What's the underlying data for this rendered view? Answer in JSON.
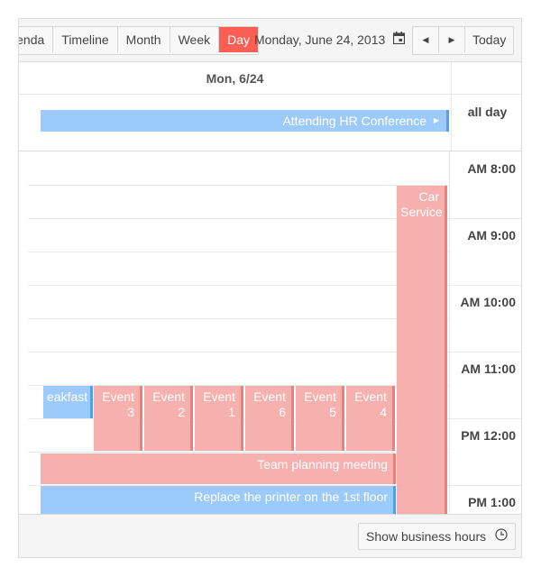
{
  "toolbar": {
    "views": [
      "Agenda",
      "Timeline",
      "Month",
      "Week",
      "Day"
    ],
    "active_view": "Day",
    "date": "Monday, June 24, 2013",
    "today": "Today",
    "accent": "#fd5e53"
  },
  "day_header": "Mon, 6/24",
  "all_day": {
    "label": "all day",
    "event": "Attending HR Conference"
  },
  "times": [
    "AM 8:00",
    "AM 9:00",
    "AM 10:00",
    "AM 11:00",
    "PM 12:00",
    "PM 1:00"
  ],
  "events": {
    "car_service": "Car Service",
    "breakfast": "eakfast with",
    "event3": "Event 3",
    "event2": "Event 2",
    "event1": "Event 1",
    "event6": "Event 6",
    "event5": "Event 5",
    "event4": "Event 4",
    "team_planning": "Team planning meeting",
    "printer": "Replace the printer on the 1st floor"
  },
  "colors": {
    "red_event": "#f6b0ae",
    "blue_event": "#9ccbfb"
  },
  "footer": {
    "business_hours": "Show business hours"
  }
}
